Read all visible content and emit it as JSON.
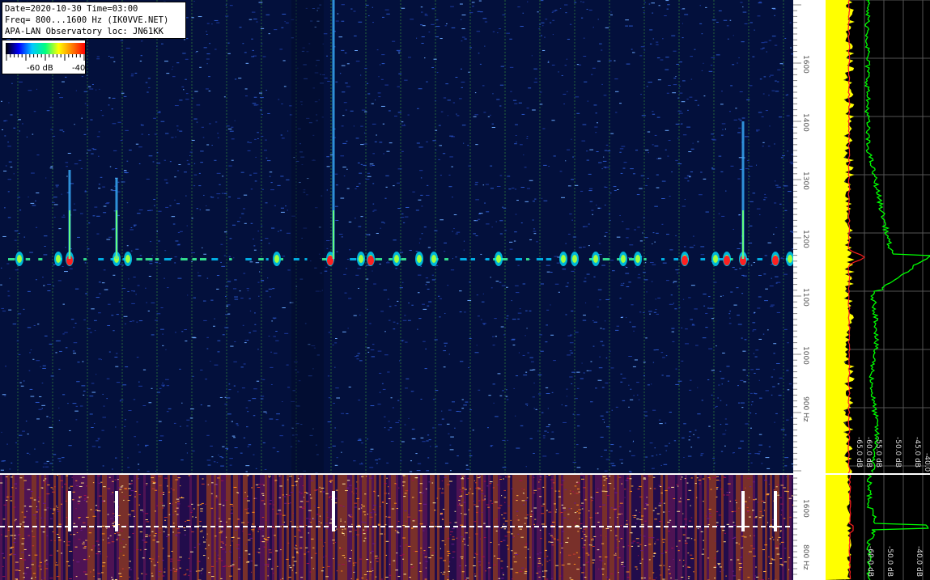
{
  "header": {
    "line1": "Date=2020-10-30 Time=03:00",
    "line2": "Freq= 800...1600 Hz (IK0VVE.NET)",
    "line3": "APA-LAN Observatory loc: JN61KK"
  },
  "colorbar": {
    "label_low": "-60 dB",
    "label_high": "-40",
    "colors": [
      "#000000",
      "#0000ff",
      "#00c8ff",
      "#00ff80",
      "#ffff00",
      "#ff8000",
      "#ff0000"
    ]
  },
  "freq_axis": {
    "unit": "Hz",
    "main_ticks": [
      "1600",
      "1400",
      "1300",
      "1200",
      "1100",
      "1000",
      "900 Hz"
    ],
    "lower_ticks": [
      "1600",
      "800 Hz"
    ]
  },
  "spectrum_panel": {
    "db_labels": [
      "-65.0 dB",
      "-60.0 dB",
      "-55.0 dB",
      "-50.0 dB",
      "-45.0 dB",
      "-40.0 dB"
    ],
    "lower_db_labels": [
      "-60.0 dB",
      "-50.0 dB",
      "-40.0 dB"
    ],
    "colors": {
      "yellow": "#ffff00",
      "green": "#00ff00",
      "red": "#ff2020",
      "grid": "#555555"
    }
  },
  "colors": {
    "waterfall_bg": "#03103c",
    "lower_bg": "#1a0a3a",
    "grid_line": "#2e7a3a"
  }
}
